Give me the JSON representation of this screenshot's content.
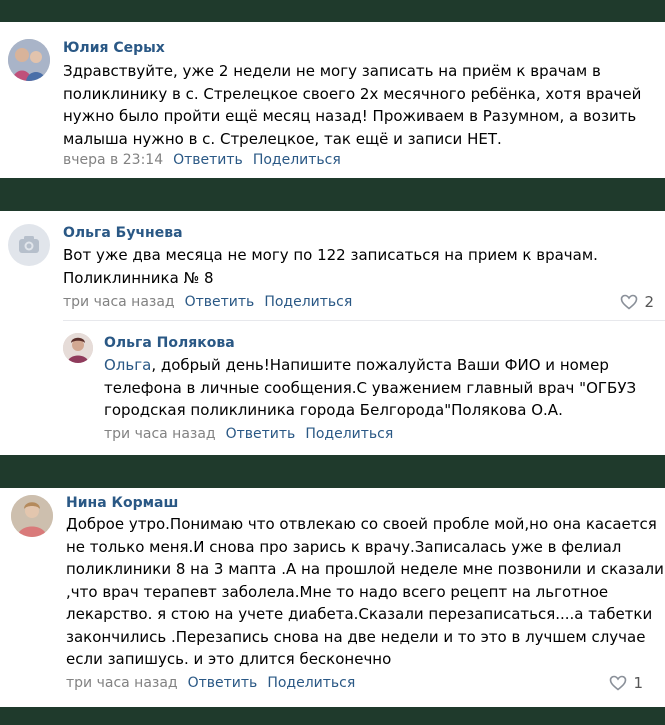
{
  "comments": [
    {
      "author": "Юлия Серых",
      "text_lines": [
        "Здравствуйте, уже 2 недели не могу записать на приём к врачам в",
        "поликлинику в с. Стрелецкое своего 2х месячного ребёнка, хотя врачей",
        "нужно было пройти ещё месяц назад! Проживаем в Разумном, а возить",
        "малыша нужно в с. Стрелецкое, так ещё и записи НЕТ."
      ],
      "time": "вчера в 23:14",
      "reply_label": "Ответить",
      "share_label": "Поделиться"
    },
    {
      "author": "Ольга Бучнева",
      "text_lines": [
        "Вот уже два месяца не могу по 122 записаться на прием к врачам.",
        "Поликлинника № 8"
      ],
      "time": "три часа назад",
      "reply_label": "Ответить",
      "share_label": "Поделиться",
      "likes": "2",
      "reply": {
        "author": "Ольга Полякова",
        "addressee": "Ольга",
        "first_line_rest": ", добрый день!Напишите пожалуйста Ваши ФИО и номер",
        "text_lines": [
          "телефона в личные сообщения.С уважением главный врач \"ОГБУЗ",
          "городская поликлиника города Белгорода\"Полякова О.А."
        ],
        "time": "три часа назад",
        "reply_label": "Ответить",
        "share_label": "Поделиться"
      }
    },
    {
      "author": "Нина Кормаш",
      "text_lines": [
        "Доброе утро.Понимаю что отвлекаю со своей пробле мой,но она касается",
        "не только меня.И снова про зарись к врачу.Записалась уже в фелиал",
        "поликлиники 8 на 3 мапта .А на прошлой неделе мне позвонили и сказали",
        ",что врач терапевт заболела.Мне то надо всего рецепт на льготное",
        "лекарство. я стою на учете диабета.Сказали перезаписаться....а табетки",
        "закончились .Перезапись снова на две недели и то это в лучшем случае",
        "если запишусь. и это длится бесконечно"
      ],
      "time": "три часа назад",
      "reply_label": "Ответить",
      "share_label": "Поделиться",
      "likes": "1"
    }
  ],
  "colors": {
    "background": "#1f3a2c",
    "card": "#ffffff",
    "author": "#2a5885",
    "meta": "#828282"
  }
}
